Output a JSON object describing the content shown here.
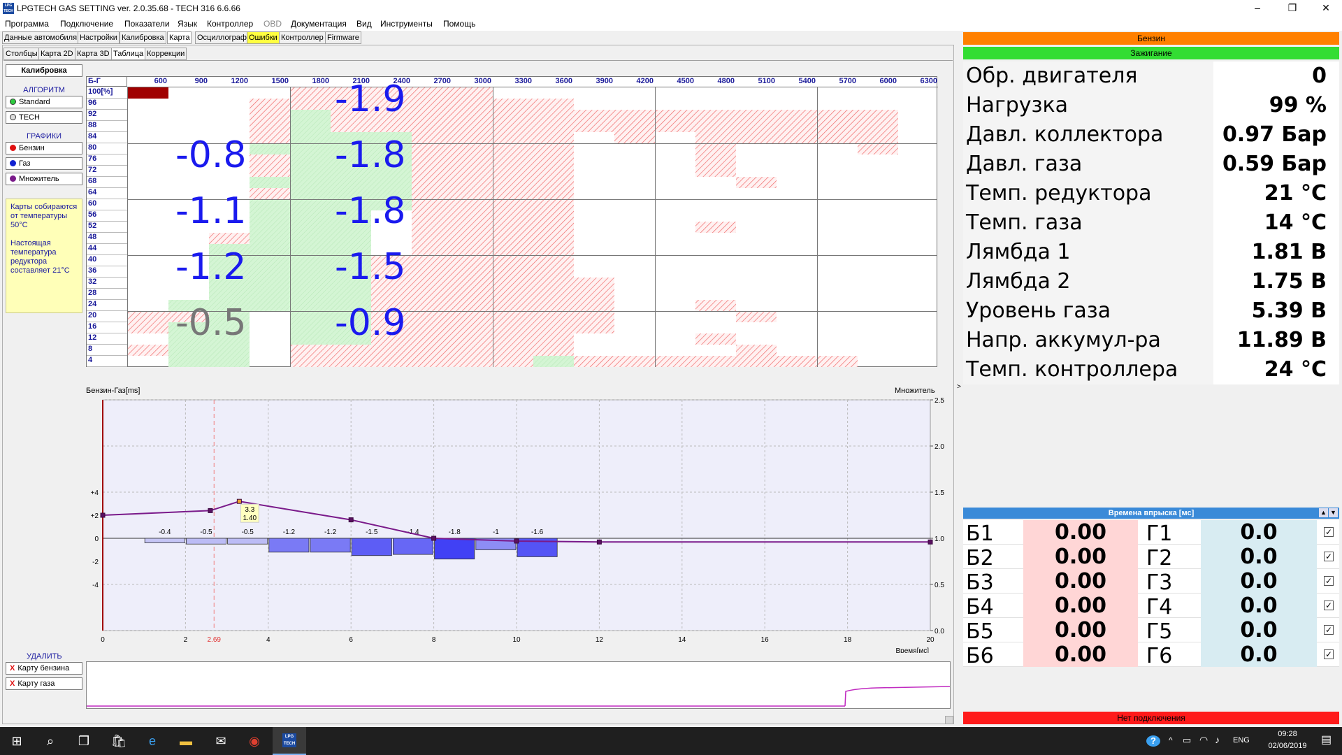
{
  "window": {
    "title": "LPGTECH GAS SETTING ver. 2.0.35.68  -  TECH 316   6.6.66",
    "logo_text": "LPG TECH",
    "min_glyph": "–",
    "max_glyph": "❐",
    "close_glyph": "✕"
  },
  "menu": [
    "Программа",
    "Подключение",
    "Показатели",
    "Язык",
    "Контроллер",
    "OBD",
    "Документация",
    "Вид",
    "Инструменты",
    "Помощь"
  ],
  "tabs_main": [
    "Данные автомобиля",
    "Настройки",
    "Калибровка",
    "Карта",
    "Осциллограф",
    "Ошибки",
    "Контроллер",
    "Firmware"
  ],
  "tabs_sub": [
    "Столбцы",
    "Карта 2D",
    "Карта 3D",
    "Таблица",
    "Коррекции"
  ],
  "sidebar": {
    "calibration_btn": "Калибровка",
    "algo_heading": "АЛГОРИТМ",
    "algo_items": [
      "Standard",
      "TECH"
    ],
    "graphs_heading": "ГРАФИКИ",
    "graph_items": [
      "Бензин",
      "Газ",
      "Множитель"
    ],
    "note_line1": "Карты собираются от температуры 50°C",
    "note_line2": "Настоящая температура редуктора составляет 21°C",
    "delete_heading": "УДАЛИТЬ",
    "delete_items": [
      "Карту бензина",
      "Карту газа"
    ],
    "delete_glyph": "X"
  },
  "grid": {
    "corner_label": "Б-Г",
    "rpm": [
      "600",
      "900",
      "1200",
      "1500",
      "1800",
      "2100",
      "2400",
      "2700",
      "3000",
      "3300",
      "3600",
      "3900",
      "4200",
      "4500",
      "4800",
      "5100",
      "5400",
      "5700",
      "6000",
      "6300"
    ],
    "loads": [
      "100[%]",
      "96",
      "92",
      "88",
      "84",
      "80",
      "76",
      "72",
      "68",
      "64",
      "60",
      "56",
      "52",
      "48",
      "44",
      "40",
      "36",
      "32",
      "28",
      "24",
      "20",
      "16",
      "12",
      "8",
      "4"
    ],
    "big_values": [
      "-1.9",
      "-0.8",
      "-1.8",
      "-1.1",
      "-1.8",
      "-1.2",
      "-1.5",
      "-0.5",
      "-0.9"
    ]
  },
  "chart_data": {
    "type": "bar",
    "left_axis_label": "Бензин-Газ[ms]",
    "right_axis_label": "Множитель",
    "xlabel": "Время[мс]",
    "x_ticks": [
      "0",
      "2",
      "2.69",
      "4",
      "6",
      "8",
      "10",
      "12",
      "14",
      "16",
      "18",
      "20"
    ],
    "left_ticks": [
      "+4",
      "+2",
      "0",
      "-2",
      "-4"
    ],
    "right_ticks": [
      "2.5",
      "2.0",
      "1.5",
      "1.0",
      "0.5",
      "0.0"
    ],
    "xlim": [
      0,
      20
    ],
    "ylim_left": [
      -8,
      12
    ],
    "ylim_right": [
      0,
      2.5
    ],
    "marker_x": 2.69,
    "bars": {
      "x_start": [
        1,
        2,
        3,
        4,
        5,
        6,
        7,
        8,
        9,
        10
      ],
      "width": 1,
      "labels": [
        "-0.4",
        "-0.5",
        "-0.5",
        "-1.2",
        "-1.2",
        "-1.5",
        "-1.4",
        "-1.8",
        "-1",
        "-1.6"
      ],
      "values": [
        -0.4,
        -0.5,
        -0.5,
        -1.2,
        -1.2,
        -1.5,
        -1.4,
        -1.8,
        -1.0,
        -1.6
      ]
    },
    "multiplier_line": {
      "x": [
        0,
        2.6,
        3.3,
        6,
        8,
        10,
        12,
        20
      ],
      "y": [
        1.25,
        1.3,
        1.4,
        1.2,
        1.0,
        0.97,
        0.96,
        0.96
      ]
    },
    "tooltip": [
      "3.3",
      "1.40"
    ]
  },
  "right_panel": {
    "fuel_banner": "Бензин",
    "ignition_banner": "Зажигание",
    "params": [
      {
        "label": "Обр. двигателя",
        "value": "0"
      },
      {
        "label": "Нагрузка",
        "value": "99 %"
      },
      {
        "label": "Давл. коллектора",
        "value": "0.97 Бар"
      },
      {
        "label": "Давл. газа",
        "value": "0.59 Бар"
      },
      {
        "label": "Темп. редуктора",
        "value": "21 °C"
      },
      {
        "label": "Темп. газа",
        "value": "14 °C"
      },
      {
        "label": "Лямбда 1",
        "value": "1.81 В"
      },
      {
        "label": "Лямбда 2",
        "value": "1.75 В"
      },
      {
        "label": "Уровень газа",
        "value": "5.39 В"
      },
      {
        "label": "Напр. аккумул-ра",
        "value": "11.89 В"
      },
      {
        "label": "Темп. контроллера",
        "value": "24 °C"
      }
    ],
    "injection_header": "Времена впрыска [мс]",
    "injection": [
      {
        "b": "Б1",
        "bv": "0.00",
        "g": "Г1",
        "gv": "0.0"
      },
      {
        "b": "Б2",
        "bv": "0.00",
        "g": "Г2",
        "gv": "0.0"
      },
      {
        "b": "Б3",
        "bv": "0.00",
        "g": "Г3",
        "gv": "0.0"
      },
      {
        "b": "Б4",
        "bv": "0.00",
        "g": "Г4",
        "gv": "0.0"
      },
      {
        "b": "Б5",
        "bv": "0.00",
        "g": "Г5",
        "gv": "0.0"
      },
      {
        "b": "Б6",
        "bv": "0.00",
        "g": "Г6",
        "gv": "0.0"
      }
    ],
    "check_glyph": "✓",
    "status_banner": "Нет подключения"
  },
  "taskbar": {
    "lang": "ENG",
    "time": "09:28",
    "date": "02/06/2019",
    "app_label": "LPG TECH"
  },
  "colors": {
    "fuel_orange": "#ff8000",
    "ignition_green": "#33dd33",
    "status_red": "#ff1a1a",
    "value_blue": "#1a1aee",
    "bar_blue": "#4a4af0",
    "line_purple": "#7a1a8a"
  }
}
